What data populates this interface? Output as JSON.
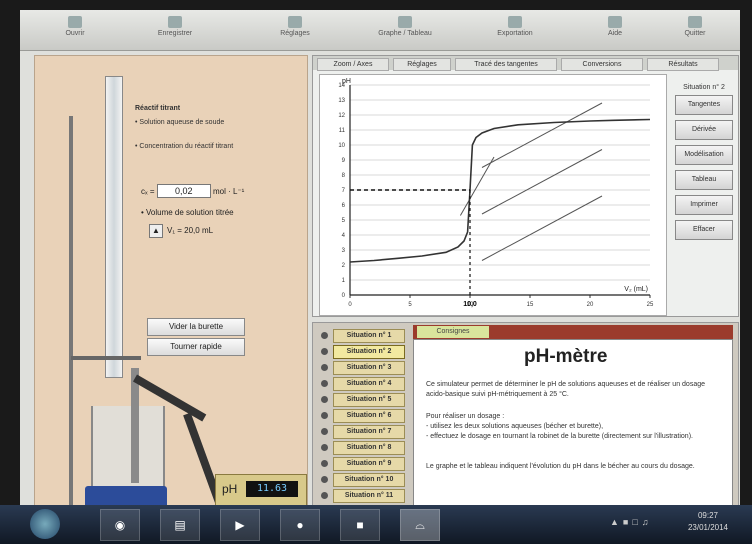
{
  "toolbar": {
    "items": [
      "Ouvrir",
      "Enregistrer",
      "Réglages",
      "Graphe / Tableau",
      "Exportation",
      "Aide",
      "Quitter"
    ]
  },
  "left": {
    "info_title": "Réactif titrant",
    "info_line1": "• Solution aqueuse de soude",
    "info_line2": "• Concentration du réactif titrant",
    "cb_label": "cₓ =",
    "cb_value": "0,02",
    "cb_unit": "mol · L⁻¹",
    "vol_line": "• Volume de solution titrée",
    "va_label": "V₁ = 20,0 mL",
    "btn_refill": "Vider la burette",
    "btn_fast": "Tourner rapide",
    "ph_label": "pH",
    "ph_value": "11.63"
  },
  "graph": {
    "tabs": [
      "Zoom / Axes",
      "Réglages",
      "Tracé des tangentes",
      "Conversions",
      "Résultats"
    ],
    "right_title": "Situation n° 2",
    "right_buttons": [
      "Tangentes",
      "Dérivée",
      "Modélisation",
      "Tableau",
      "Imprimer",
      "Effacer"
    ],
    "cursor_label": "10,0"
  },
  "chart_data": {
    "type": "line",
    "title": "",
    "xlabel": "V₂ (mL)",
    "ylabel": "pH",
    "xlim": [
      0,
      25
    ],
    "ylim": [
      0,
      14
    ],
    "x_ticks": [
      0,
      5,
      10,
      15,
      20,
      25
    ],
    "y_ticks": [
      0,
      1,
      2,
      3,
      4,
      5,
      6,
      7,
      8,
      9,
      10,
      11,
      12,
      13,
      14
    ],
    "grid": true,
    "series": [
      {
        "x": [
          0,
          2,
          4,
          6,
          8,
          9,
          9.5,
          9.8,
          10,
          10.2,
          10.5,
          11,
          12,
          14,
          17,
          20,
          22,
          25
        ],
        "y": [
          2.2,
          2.3,
          2.45,
          2.6,
          2.85,
          3.2,
          3.6,
          4.2,
          7.0,
          10.0,
          10.5,
          10.8,
          11.1,
          11.35,
          11.5,
          11.6,
          11.65,
          11.7
        ]
      }
    ],
    "equivalence": {
      "x": 10.0,
      "y": 7.0
    }
  },
  "situations": {
    "items": [
      "Situation n° 1",
      "Situation n° 2",
      "Situation n° 3",
      "Situation n° 4",
      "Situation n° 5",
      "Situation n° 6",
      "Situation n° 7",
      "Situation n° 8",
      "Situation n° 9",
      "Situation n° 10",
      "Situation n° 11"
    ],
    "active_index": 1
  },
  "doc": {
    "tab_label": "Consignes",
    "title": "pH-mètre",
    "para1": "Ce simulateur permet de déterminer le pH de solutions aqueuses et de réaliser un dosage acido-basique suivi pH-métriquement à 25 °C.",
    "para2": "Pour réaliser un dosage :",
    "para3": "- utilisez les deux solutions aqueuses (bécher et burette),",
    "para4": "- effectuez le dosage en tournant la robinet de la burette (directement sur l'illustration).",
    "para5": "Le graphe et le tableau indiquent l'évolution du pH dans le bécher au cours du dosage."
  },
  "taskbar": {
    "clock_time": "09:27",
    "clock_date": "23/01/2014"
  }
}
